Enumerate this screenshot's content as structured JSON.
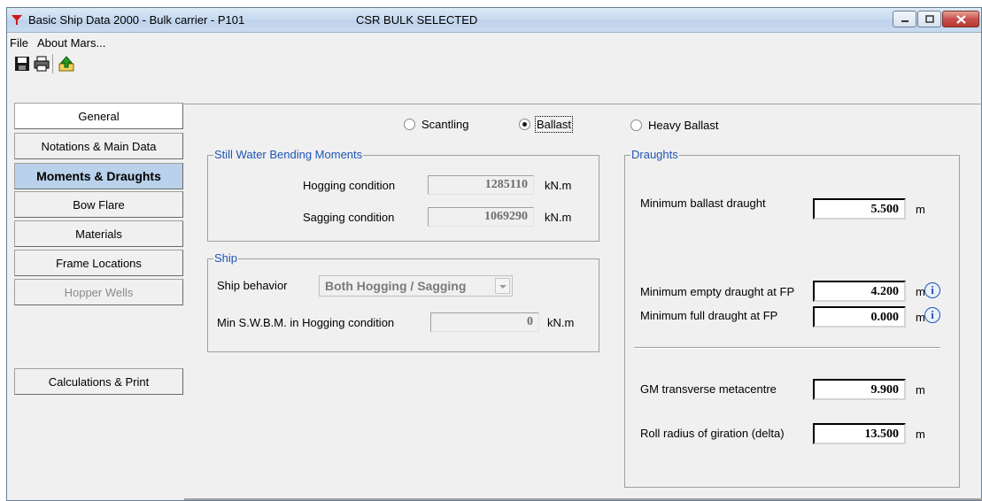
{
  "window": {
    "title": "Basic Ship Data 2000 - Bulk carrier - P101",
    "status": "CSR BULK SELECTED"
  },
  "menu": {
    "file": "File",
    "about": "About Mars..."
  },
  "toolbar": {
    "save_icon": "save-icon",
    "print_icon": "printer-icon",
    "export_icon": "export-icon"
  },
  "sidebar": {
    "items": [
      {
        "label": "General"
      },
      {
        "label": "Notations & Main Data"
      },
      {
        "label": "Moments & Draughts"
      },
      {
        "label": "Bow Flare"
      },
      {
        "label": "Materials"
      },
      {
        "label": "Frame Locations"
      },
      {
        "label": "Hopper Wells"
      },
      {
        "label": "Calculations & Print"
      }
    ],
    "active": "Moments & Draughts"
  },
  "modes": {
    "scantling": "Scantling",
    "ballast": "Ballast",
    "heavy_ballast": "Heavy Ballast",
    "selected": "Ballast"
  },
  "swbm": {
    "title": "Still Water Bending Moments",
    "hogging_label": "Hogging condition",
    "hogging_value": "1285110",
    "sagging_label": "Sagging  condition",
    "sagging_value": "1069290",
    "unit": "kN.m"
  },
  "ship": {
    "title": "Ship",
    "behavior_label": "Ship behavior",
    "behavior_value": "Both Hogging / Sagging",
    "min_swbm_label": "Min S.W.B.M. in Hogging condition",
    "min_swbm_value": "0",
    "unit": "kN.m"
  },
  "draughts": {
    "title": "Draughts",
    "min_ballast_label": "Minimum ballast draught",
    "min_ballast_value": "5.500",
    "min_empty_fp_label": "Minimum empty draught at FP",
    "min_empty_fp_value": "4.200",
    "min_full_fp_label": "Minimum full draught at FP",
    "min_full_fp_value": "0.000",
    "gm_label": "GM transverse metacentre",
    "gm_value": "9.900",
    "roll_label": "Roll radius of giration (delta)",
    "roll_value": "13.500",
    "unit": "m"
  }
}
